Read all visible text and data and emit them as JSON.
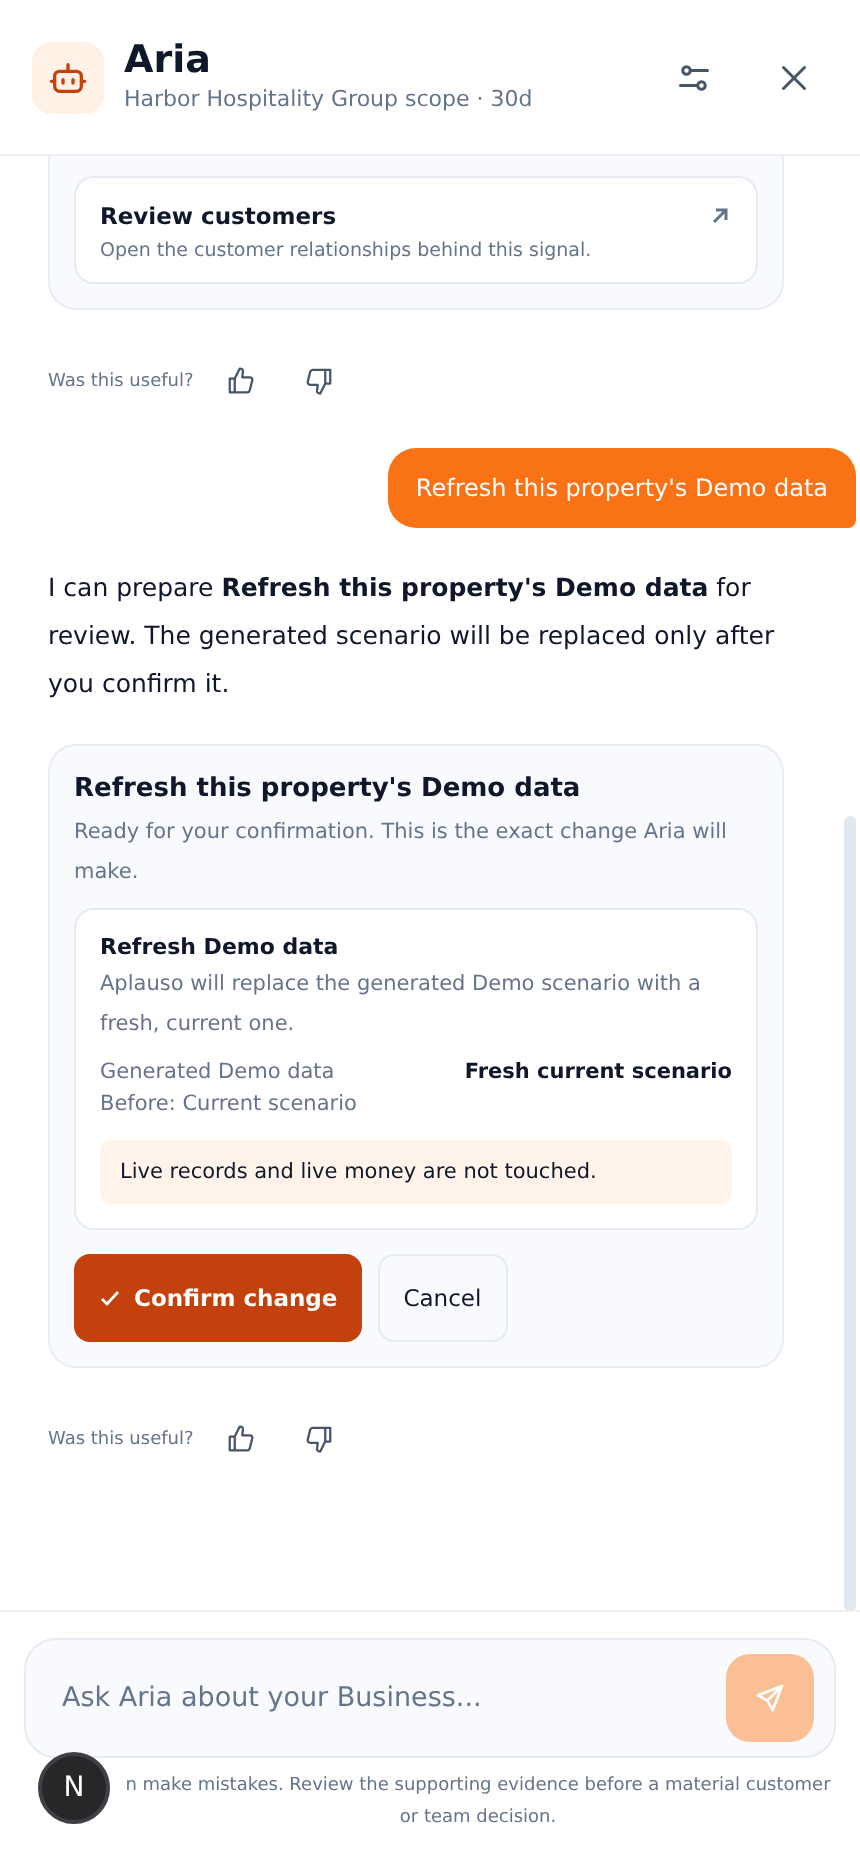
{
  "header": {
    "title": "Aria",
    "subtitle": "Harbor Hospitality Group scope · 30d"
  },
  "messages": [
    {
      "kind": "link_card",
      "title": "Review customers",
      "description": "Open the customer relationships behind this signal."
    },
    {
      "kind": "feedback",
      "label": "Was this useful?"
    },
    {
      "kind": "user",
      "text": "Refresh this property's Demo data"
    },
    {
      "kind": "assistant",
      "text": "I can prepare **Refresh this property's Demo data** for review. The generated scenario will be replaced only after you confirm it."
    },
    {
      "kind": "confirm_card",
      "title": "Refresh this property's Demo data",
      "description": "Ready for your confirmation. This is the exact change Aria will make.",
      "change": {
        "title": "Refresh Demo data",
        "description": "Aplauso will replace the generated Demo scenario with a fresh, current one.",
        "field": "Generated Demo data",
        "new_value": "Fresh current scenario",
        "before": "Before: Current scenario",
        "note": "Live records and live money are not touched."
      },
      "confirm": "Confirm change",
      "cancel": "Cancel"
    },
    {
      "kind": "feedback",
      "label": "Was this useful?"
    }
  ],
  "composer": {
    "placeholder": "Ask Aria about your Business...",
    "send_disabled": true,
    "disclaimer": "n make mistakes. Review the supporting evidence before a material customer or team decision."
  },
  "badge": "N"
}
